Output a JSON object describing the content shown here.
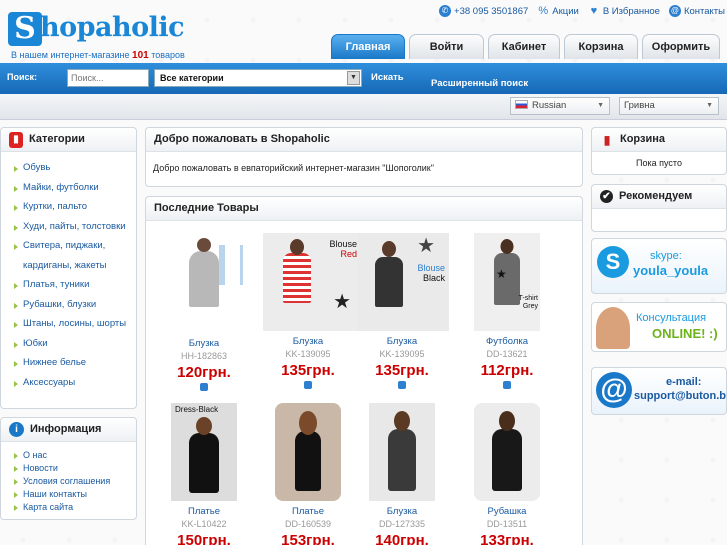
{
  "header": {
    "logo_initial": "S",
    "logo_text": "hopaholic",
    "tagline_prefix": "В нашем интернет-магазине",
    "tagline_count": "101",
    "tagline_suffix": "товаров",
    "phone": "+38 095 3501867",
    "promo": "Акции",
    "favorites": "В Избранное",
    "contacts": "Контакты"
  },
  "tabs": [
    {
      "label": "Главная",
      "active": true
    },
    {
      "label": "Войти"
    },
    {
      "label": "Кабинет"
    },
    {
      "label": "Корзина"
    },
    {
      "label": "Оформить"
    }
  ],
  "search": {
    "label": "Поиск:",
    "placeholder": "Поиск...",
    "category_value": "Все категории",
    "button": "Искать",
    "advanced": "Расширенный поиск"
  },
  "language": {
    "value": "Russian"
  },
  "currency": {
    "value": "Гривна"
  },
  "categories": {
    "title": "Категории",
    "items": [
      "Обувь",
      "Майки, футболки",
      "Куртки, пальто",
      "Худи, пайты, толстовки",
      "Свитера, пиджаки,",
      "кардиганы, жакеты",
      "Платья, туники",
      "Рубашки, блузки",
      "Штаны, лосины, шорты",
      "Юбки",
      "Нижнее белье",
      "Аксессуары"
    ]
  },
  "info": {
    "title": "Информация",
    "items": [
      "О нас",
      "Новости",
      "Условия соглашения",
      "Наши контакты",
      "Карта сайта"
    ]
  },
  "welcome": {
    "title": "Добро пожаловать в Shopaholic",
    "text": "Добро пожаловать в евпаторийский интернет-магазин \"Шопоголик\""
  },
  "latest": {
    "title": "Последние Товары",
    "products": [
      {
        "name": "Блузка",
        "code": "HH-182863",
        "price": "120грн."
      },
      {
        "name": "Блузка",
        "code": "KK-139095",
        "price": "135грн.",
        "overlay": "Blouse",
        "overlay2": "Red"
      },
      {
        "name": "Блузка",
        "code": "KK-139095",
        "price": "135грн.",
        "overlay": "Blouse",
        "overlay2": "Black"
      },
      {
        "name": "Футболка",
        "code": "DD-13621",
        "price": "112грн.",
        "overlay": "T-shirt",
        "overlay2": "Grey"
      },
      {
        "name": "Платье",
        "code": "KK-L10422",
        "price": "150грн.",
        "overlay": "Dress-Black"
      },
      {
        "name": "Платье",
        "code": "DD-160539",
        "price": "153грн."
      },
      {
        "name": "Блузка",
        "code": "DD-127335",
        "price": "140грн."
      },
      {
        "name": "Рубашка",
        "code": "DD-13511",
        "price": "133грн."
      }
    ]
  },
  "cart": {
    "title": "Корзина",
    "empty": "Пока пусто"
  },
  "recommend": {
    "title": "Рекомендуем"
  },
  "banners": {
    "skype_label": "skype:",
    "skype_user": "youla_youla",
    "consult_line1": "Консультация",
    "consult_line2": "ONLINE! :)",
    "email_label": "e-mail:",
    "email_value": "support@buton.biz"
  },
  "colors": {
    "accent": "#1a78c8",
    "price": "#cc0000",
    "bullet": "#9bc34a"
  }
}
